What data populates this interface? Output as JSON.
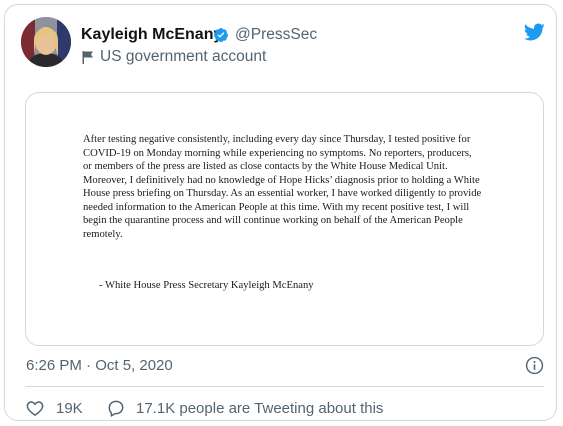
{
  "tweet": {
    "author_name": "Kayleigh McEnany",
    "handle": "@PressSec",
    "label": "US government account",
    "timestamp": "6:26 PM · Oct 5, 2020",
    "likes": "19K",
    "talking": "17.1K people are Tweeting about this"
  },
  "image": {
    "body": "After testing negative consistently, including every day since Thursday, I tested positive for COVID-19 on Monday morning while experiencing no symptoms.  No reporters, producers, or members of the press are listed as close contacts by the White House Medical Unit. Moreover, I definitively had no knowledge of Hope Hicks’ diagnosis prior to holding a White House press briefing on Thursday. As an essential worker, I have worked diligently to provide needed information to the American People at this time. With my recent positive test, I will begin the quarantine process and will continue working on behalf of the American People remotely.",
    "signature": "-     White House Press Secretary Kayleigh McEnany"
  },
  "colors": {
    "twitter_blue": "#1d9bf0",
    "secondary_text": "#536471",
    "border": "#cfd9de"
  },
  "icons": {
    "verified": "verified-badge-icon",
    "government": "flag-icon",
    "brand": "twitter-bird-icon",
    "info": "info-icon",
    "like": "heart-icon",
    "reply": "speech-bubble-icon"
  }
}
